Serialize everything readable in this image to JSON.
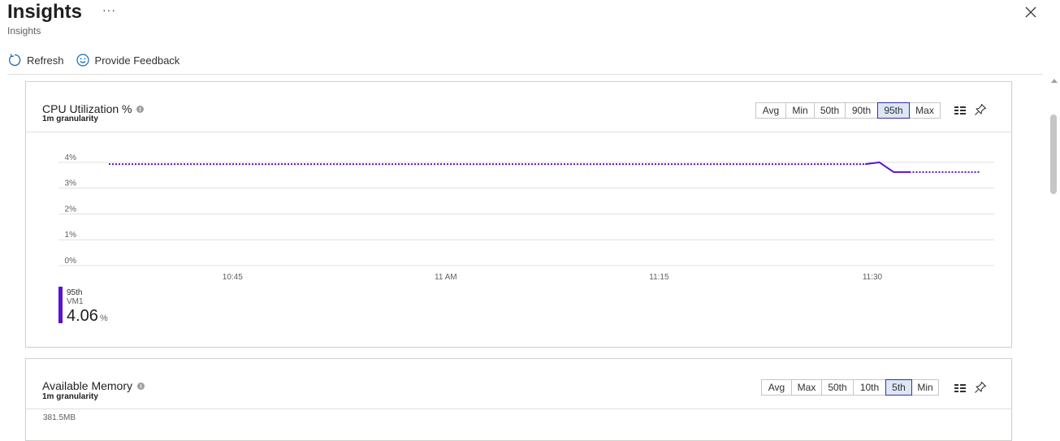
{
  "header": {
    "title": "Insights",
    "subtitle": "Insights",
    "more": "···"
  },
  "toolbar": {
    "refresh_label": "Refresh",
    "feedback_label": "Provide Feedback"
  },
  "cpu_card": {
    "title": "CPU Utilization %",
    "granularity": "1m granularity",
    "aggregations": [
      "Avg",
      "Min",
      "50th",
      "90th",
      "95th",
      "Max"
    ],
    "selected": "95th",
    "legend": {
      "series": "95th",
      "resource": "VM1",
      "value": "4.06",
      "unit": "%"
    }
  },
  "memory_card": {
    "title": "Available Memory",
    "granularity": "1m granularity",
    "aggregations": [
      "Avg",
      "Max",
      "50th",
      "10th",
      "5th",
      "Min"
    ],
    "selected": "5th",
    "y_top_label": "381.5MB"
  },
  "chart_data": {
    "type": "line",
    "title": "CPU Utilization %",
    "y_ticks": [
      "0%",
      "1%",
      "2%",
      "3%",
      "4%"
    ],
    "x_ticks": [
      {
        "label": "10:45",
        "t": 45
      },
      {
        "label": "11 AM",
        "t": 60
      },
      {
        "label": "11:15",
        "t": 75
      },
      {
        "label": "11:30",
        "t": 90
      }
    ],
    "ylim": [
      0,
      4.2
    ],
    "xlim": [
      34.7,
      97.6
    ],
    "grid": true,
    "series": [
      {
        "name": "95th",
        "color": "#5c10d3",
        "dotted": [
          [
            36.3,
            3.93
          ],
          [
            89.5,
            3.93
          ]
        ],
        "solid": [
          [
            89.5,
            3.93
          ],
          [
            90.5,
            4.0
          ],
          [
            91.5,
            3.62
          ],
          [
            92.6,
            3.62
          ]
        ],
        "dotted_end": [
          [
            92.6,
            3.62
          ],
          [
            97.6,
            3.62
          ]
        ]
      }
    ]
  }
}
